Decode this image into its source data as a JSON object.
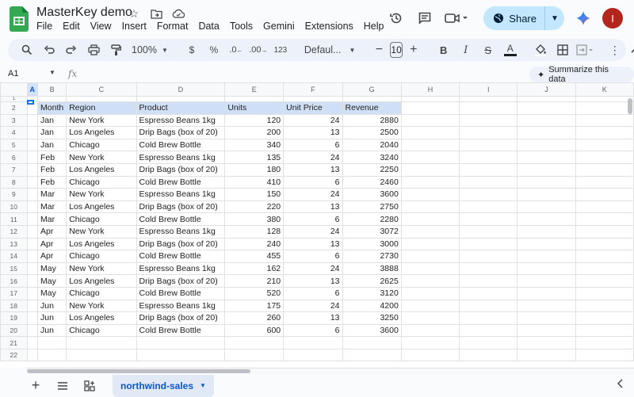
{
  "app": {
    "title": "MasterKey demo",
    "menu": [
      "File",
      "Edit",
      "View",
      "Insert",
      "Format",
      "Data",
      "Tools",
      "Gemini",
      "Extensions",
      "Help"
    ],
    "share_label": "Share",
    "avatar_initial": "I",
    "colors": {
      "accent": "#0b57d0",
      "share_bg": "#c2e7ff",
      "avatar": "#b3261e",
      "header_fill": "#cfdff5"
    }
  },
  "toolbar": {
    "zoom": "100%",
    "currency": "$",
    "percent": "%",
    "dec_less": ".0",
    "dec_more": ".00",
    "format_123": "123",
    "font": "Defaul...",
    "font_size": "10"
  },
  "formula": {
    "cell_ref": "A1",
    "fx": "fx",
    "summarize": "Summarize this data"
  },
  "grid": {
    "columns": [
      "A",
      "B",
      "C",
      "D",
      "E",
      "F",
      "G",
      "H",
      "I",
      "J",
      "K"
    ],
    "header_row": [
      "Month",
      "Region",
      "Product",
      "Units",
      "Unit Price",
      "Revenue"
    ],
    "rows": [
      [
        "Jan",
        "New York",
        "Espresso Beans 1kg",
        "120",
        "24",
        "2880"
      ],
      [
        "Jan",
        "Los Angeles",
        "Drip Bags (box of 20)",
        "200",
        "13",
        "2500"
      ],
      [
        "Jan",
        "Chicago",
        "Cold Brew Bottle",
        "340",
        "6",
        "2040"
      ],
      [
        "Feb",
        "New York",
        "Espresso Beans 1kg",
        "135",
        "24",
        "3240"
      ],
      [
        "Feb",
        "Los Angeles",
        "Drip Bags (box of 20)",
        "180",
        "13",
        "2250"
      ],
      [
        "Feb",
        "Chicago",
        "Cold Brew Bottle",
        "410",
        "6",
        "2460"
      ],
      [
        "Mar",
        "New York",
        "Espresso Beans 1kg",
        "150",
        "24",
        "3600"
      ],
      [
        "Mar",
        "Los Angeles",
        "Drip Bags (box of 20)",
        "220",
        "13",
        "2750"
      ],
      [
        "Mar",
        "Chicago",
        "Cold Brew Bottle",
        "380",
        "6",
        "2280"
      ],
      [
        "Apr",
        "New York",
        "Espresso Beans 1kg",
        "128",
        "24",
        "3072"
      ],
      [
        "Apr",
        "Los Angeles",
        "Drip Bags (box of 20)",
        "240",
        "13",
        "3000"
      ],
      [
        "Apr",
        "Chicago",
        "Cold Brew Bottle",
        "455",
        "6",
        "2730"
      ],
      [
        "May",
        "New York",
        "Espresso Beans 1kg",
        "162",
        "24",
        "3888"
      ],
      [
        "May",
        "Los Angeles",
        "Drip Bags (box of 20)",
        "210",
        "13",
        "2625"
      ],
      [
        "May",
        "Chicago",
        "Cold Brew Bottle",
        "520",
        "6",
        "3120"
      ],
      [
        "Jun",
        "New York",
        "Espresso Beans 1kg",
        "175",
        "24",
        "4200"
      ],
      [
        "Jun",
        "Los Angeles",
        "Drip Bags (box of 20)",
        "260",
        "13",
        "3250"
      ],
      [
        "Jun",
        "Chicago",
        "Cold Brew Bottle",
        "600",
        "6",
        "3600"
      ]
    ],
    "extra_row_numbers": [
      "21",
      "22"
    ]
  },
  "sheet": {
    "tab_name": "northwind-sales"
  }
}
